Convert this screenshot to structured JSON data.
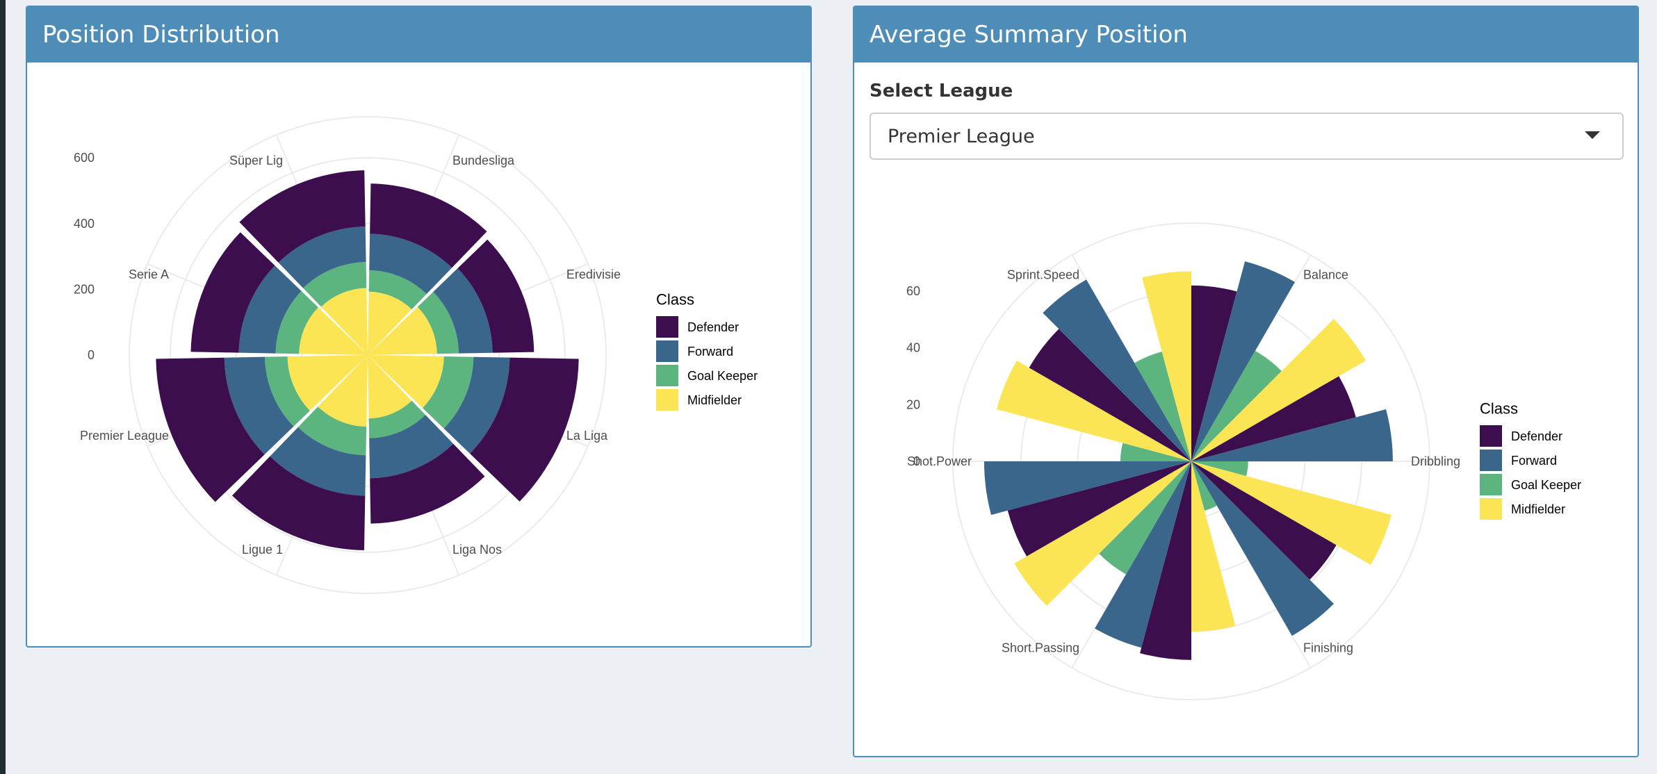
{
  "panels": {
    "left": {
      "title": "Position Distribution"
    },
    "right": {
      "title": "Average Summary Position",
      "select_label": "Select League",
      "select_value": "Premier League"
    }
  },
  "colors": {
    "Defender": "#3d0e4e",
    "Forward": "#3b668b",
    "Goal Keeper": "#5cb57e",
    "Midfielder": "#fbe555",
    "header": "#4f8db9"
  },
  "chart_data": [
    {
      "type": "bar",
      "polar": true,
      "stacked": true,
      "categories": [
        "Bundesliga",
        "Eredivisie",
        "La Liga",
        "Liga Nos",
        "Ligue 1",
        "Premier League",
        "Serie A",
        "Süper Lig"
      ],
      "series": [
        {
          "name": "Defender",
          "values": [
            153,
            126,
            210,
            138,
            166,
            208,
            146,
            171
          ]
        },
        {
          "name": "Forward",
          "values": [
            111,
            103,
            110,
            122,
            123,
            123,
            112,
            108
          ]
        },
        {
          "name": "Goal Keeper",
          "values": [
            65,
            66,
            90,
            60,
            87,
            69,
            71,
            79
          ]
        },
        {
          "name": "Midfielder",
          "values": [
            193,
            211,
            232,
            193,
            218,
            244,
            209,
            204
          ]
        }
      ],
      "yticks": [
        0,
        200,
        400,
        600
      ],
      "ylim": [
        0,
        725
      ],
      "legend_title": "Class",
      "legend_position": "right"
    },
    {
      "type": "bar",
      "polar": true,
      "stacked": false,
      "categories": [
        "Balance",
        "Dribbling",
        "Finishing",
        "Short.Passing",
        "Shot.Power",
        "Sprint.Speed"
      ],
      "series": [
        {
          "name": "Defender",
          "values": [
            62,
            60,
            59,
            70,
            67,
            66
          ]
        },
        {
          "name": "Forward",
          "values": [
            73,
            71,
            71,
            68,
            73,
            74
          ]
        },
        {
          "name": "Goal Keeper",
          "values": [
            45,
            20,
            18,
            46,
            25,
            40
          ]
        },
        {
          "name": "Midfielder",
          "values": [
            71,
            73,
            60,
            72,
            71,
            67
          ]
        }
      ],
      "yticks": [
        0,
        20,
        40,
        60
      ],
      "ylim": [
        0,
        84
      ],
      "legend_title": "Class",
      "legend_position": "right"
    }
  ]
}
